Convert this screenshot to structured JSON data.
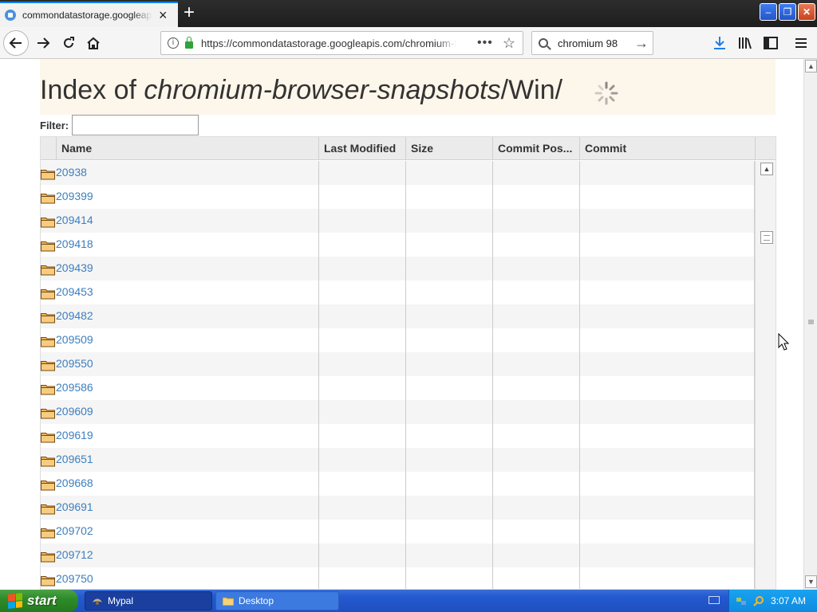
{
  "browser": {
    "tab_title": "commondatastorage.googleapis.com/chromium-browser-snapshots/Win/",
    "new_tab_label": "+",
    "url": "https://commondatastorage.googleapis.com/chromium-browser-snapshots/Win/",
    "search_value": "chromium 98",
    "window_controls": {
      "minimize": "–",
      "restore": "❐",
      "close": "✕"
    },
    "icons": [
      "back-arrow-icon",
      "forward-arrow-icon",
      "reload-icon",
      "home-icon",
      "info-icon",
      "lock-icon",
      "page-actions-icon",
      "bookmark-star-icon",
      "search-icon",
      "go-arrow-icon",
      "download-icon",
      "library-icon",
      "sidebar-icon",
      "hamburger-menu-icon"
    ]
  },
  "page": {
    "title_prefix": "Index of ",
    "title_path": "chromium-browser-snapshots",
    "title_suffix": "/Win/",
    "filter_label": "Filter:",
    "filter_value": "",
    "columns": [
      "Name",
      "Last Modified",
      "Size",
      "Commit Pos...",
      "Commit"
    ],
    "rows": [
      "20938",
      "209399",
      "209414",
      "209418",
      "209439",
      "209453",
      "209482",
      "209509",
      "209550",
      "209586",
      "209609",
      "209619",
      "209651",
      "209668",
      "209691",
      "209702",
      "209712",
      "209750"
    ],
    "link_color": "#3d7fbf"
  },
  "taskbar": {
    "start_label": "start",
    "tasks": [
      "Mypal",
      "Desktop"
    ],
    "clock": "3:07 AM"
  }
}
